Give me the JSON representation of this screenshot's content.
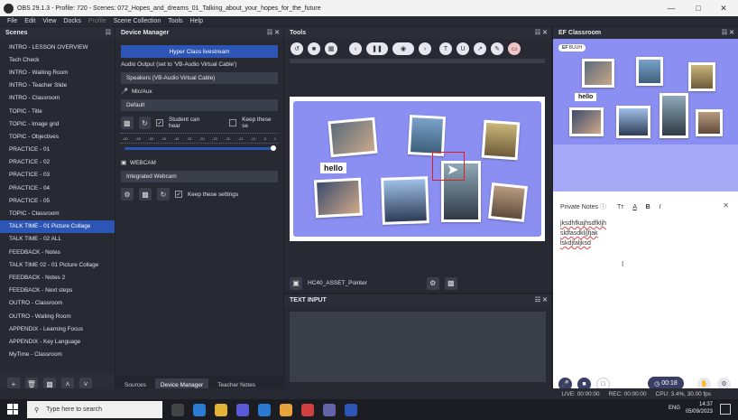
{
  "window": {
    "title": "OBS 29.1.3 - Profile: 720 - Scenes: 072_Hopes_and_dreams_01_Talking_about_your_hopes_for_the_future"
  },
  "menu": [
    "File",
    "Edit",
    "View",
    "Docks",
    "Profile",
    "Scene Collection",
    "Tools",
    "Help"
  ],
  "scenes": {
    "title": "Scenes",
    "items": [
      "INTRO - LESSON OVERVIEW",
      "Tech Check",
      "INTRO - Waiting Room",
      "INTRO - Teacher Slide",
      "INTRO - Classroom",
      "TOPIC - Title",
      "TOPIC - Image grid",
      "TOPIC - Objectives",
      "PRACTICE - 01",
      "PRACTICE - 02",
      "PRACTICE - 03",
      "PRACTICE - 04",
      "PRACTICE - 05",
      "TOPIC - Classroom",
      "TALK TIME - 01 Picture Collage",
      "TALK TIME - 02 ALL",
      "FEEDBACK - Notes",
      "TALK TIME 02 - 01 Picture Collage",
      "FEEDBACK - Notes 2",
      "FEEDBACK - Next steps",
      "OUTRO - Classroom",
      "OUTRO - Waiting Room",
      "APPENDIX - Learning Focus",
      "APPENDIX - Key Language",
      "MyTime - Classroom"
    ],
    "selected": "TALK TIME - 01 Picture Collage"
  },
  "device_manager": {
    "title": "Device Manager",
    "livestream_button": "Hyper Class livestream",
    "audio_output_label": "Audio Output (set to 'VB-Audio Virtual Cable')",
    "audio_output_value": "Speakers (VB-Audio Virtual Cable)",
    "mic_label": "Mic/Aux",
    "mic_value": "Default",
    "student_can_hear": "Student can hear",
    "keep_settings_truncated": "Keep these se",
    "meter_ticks": [
      "-60",
      "-55",
      "-50",
      "-45",
      "-40",
      "-35",
      "-30",
      "-25",
      "-20",
      "-15",
      "-10",
      "-5",
      "0"
    ],
    "webcam_label": "WEBCAM",
    "webcam_value": "Integrated Webcam",
    "keep_settings": "Keep these settings",
    "tabs": [
      "Sources",
      "Device Manager",
      "Teacher Notes"
    ],
    "active_tab": "Device Manager"
  },
  "tools": {
    "title": "Tools",
    "canvas_label": "hello",
    "pointer_source": "HC40_ASSET_Pointer"
  },
  "text_input": {
    "title": "TEXT INPUT"
  },
  "ef_classroom": {
    "title": "EF Classroom",
    "session_name": "BUUH",
    "stage_label": "hello",
    "notes_title": "Private Notes",
    "notes_lines": [
      "jksdhfkajhsdfkljh",
      "sldfasdklj]fjak",
      "lskdjfaljksd"
    ],
    "timer": "00:18"
  },
  "status": {
    "live": "LIVE: 00:00:00",
    "rec": "REC: 00:00:00",
    "cpu": "CPU: 3.4%, 30.00 fps"
  },
  "taskbar": {
    "search_placeholder": "Type here to search",
    "language": "ENG",
    "time": "14:37",
    "date": "05/09/2023"
  },
  "colors": {
    "accent": "#2c55b5",
    "stage": "#8b8ff2",
    "panel": "#272a33"
  }
}
